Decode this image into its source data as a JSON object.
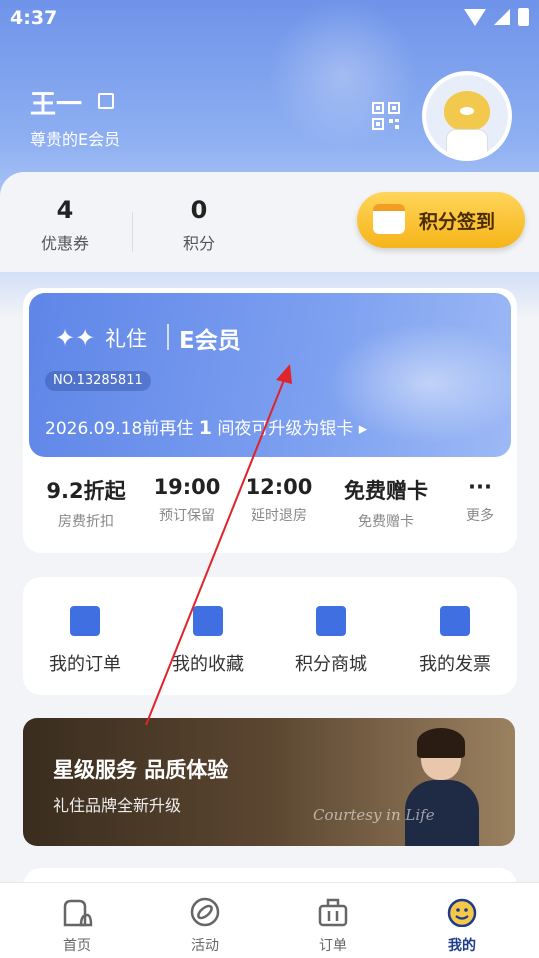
{
  "status_bar": {
    "time": "4:37"
  },
  "profile": {
    "name": "王一",
    "level": "尊贵的E会员"
  },
  "stats": [
    {
      "value": "4",
      "label": "优惠券"
    },
    {
      "value": "0",
      "label": "积分"
    }
  ],
  "checkin": {
    "label": "积分签到"
  },
  "member_card": {
    "brand": "礼住",
    "tier": "E会员",
    "number": "NO.13285811",
    "upgrade_prefix": "2026.09.18前再住",
    "upgrade_count": "1",
    "upgrade_suffix": "间夜可升级为银卡"
  },
  "benefits": [
    {
      "value": "9.2折起",
      "label": "房费折扣"
    },
    {
      "value": "19:00",
      "label": "预订保留"
    },
    {
      "value": "12:00",
      "label": "延时退房"
    },
    {
      "value": "免费赠卡",
      "label": "免费赠卡"
    },
    {
      "value": "···",
      "label": "更多"
    }
  ],
  "quick_actions": [
    {
      "label": "我的订单",
      "icon": "order-icon"
    },
    {
      "label": "我的收藏",
      "icon": "favorite-icon"
    },
    {
      "label": "积分商城",
      "icon": "mall-icon"
    },
    {
      "label": "我的发票",
      "icon": "invoice-icon"
    }
  ],
  "banner": {
    "title": "星级服务 品质体验",
    "subtitle": "礼住品牌全新升级",
    "script": "Courtesy in Life"
  },
  "tabbar": [
    {
      "label": "首页",
      "icon": "home-icon",
      "active": false
    },
    {
      "label": "活动",
      "icon": "activity-icon",
      "active": false
    },
    {
      "label": "订单",
      "icon": "orders-icon",
      "active": false
    },
    {
      "label": "我的",
      "icon": "profile-icon",
      "active": true
    }
  ],
  "colors": {
    "accent": "#3f6fe0",
    "card_blue": "#6f93e9",
    "checkin_gold": "#f6b419",
    "annotation_arrow": "#e0242b"
  }
}
